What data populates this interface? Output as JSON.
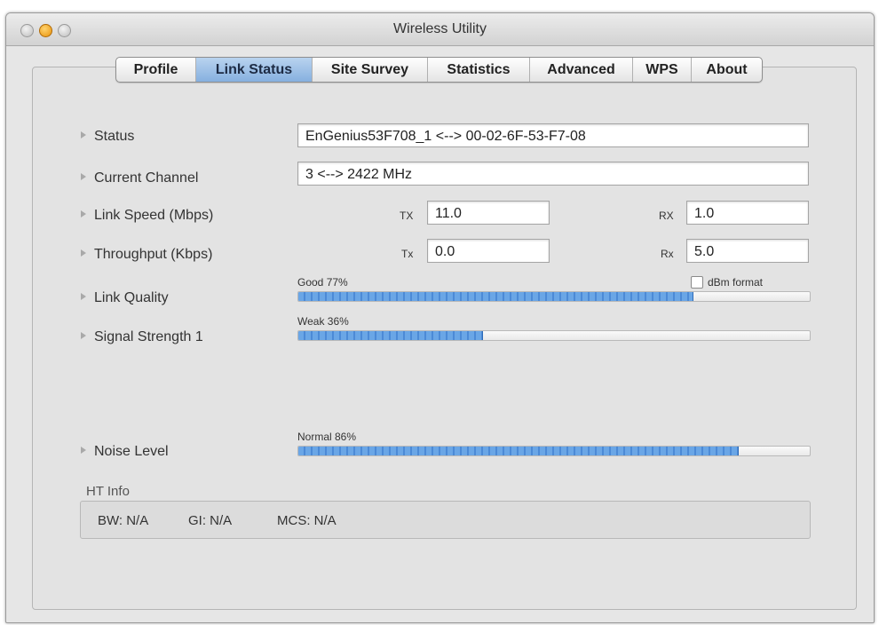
{
  "window": {
    "title": "Wireless Utility"
  },
  "tabs": [
    {
      "label": "Profile",
      "active": false
    },
    {
      "label": "Link Status",
      "active": true
    },
    {
      "label": "Site Survey",
      "active": false
    },
    {
      "label": "Statistics",
      "active": false
    },
    {
      "label": "Advanced",
      "active": false
    },
    {
      "label": "WPS",
      "active": false
    },
    {
      "label": "About",
      "active": false
    }
  ],
  "status": {
    "label": "Status",
    "value": "EnGenius53F708_1 <--> 00-02-6F-53-F7-08"
  },
  "channel": {
    "label": "Current Channel",
    "value": "3 <--> 2422 MHz"
  },
  "link_speed": {
    "label": "Link Speed (Mbps)",
    "tx_label": "TX",
    "tx_value": "11.0",
    "rx_label": "RX",
    "rx_value": "1.0"
  },
  "throughput": {
    "label": "Throughput (Kbps)",
    "tx_label": "Tx",
    "tx_value": "0.0",
    "rx_label": "Rx",
    "rx_value": "5.0"
  },
  "link_quality": {
    "label": "Link Quality",
    "caption": "Good 77%",
    "percent": 77,
    "dbm_label": "dBm format",
    "dbm_checked": false
  },
  "signal_strength": {
    "label": "Signal Strength 1",
    "caption": "Weak 36%",
    "percent": 36
  },
  "noise_level": {
    "label": "Noise Level",
    "caption": "Normal 86%",
    "percent": 86
  },
  "ht_info": {
    "title": "HT Info",
    "bw": "BW: N/A",
    "gi": "GI: N/A",
    "mcs": "MCS: N/A"
  },
  "colors": {
    "bar_fill": "#6aa6e6",
    "active_tab": "#9fc2e8"
  }
}
